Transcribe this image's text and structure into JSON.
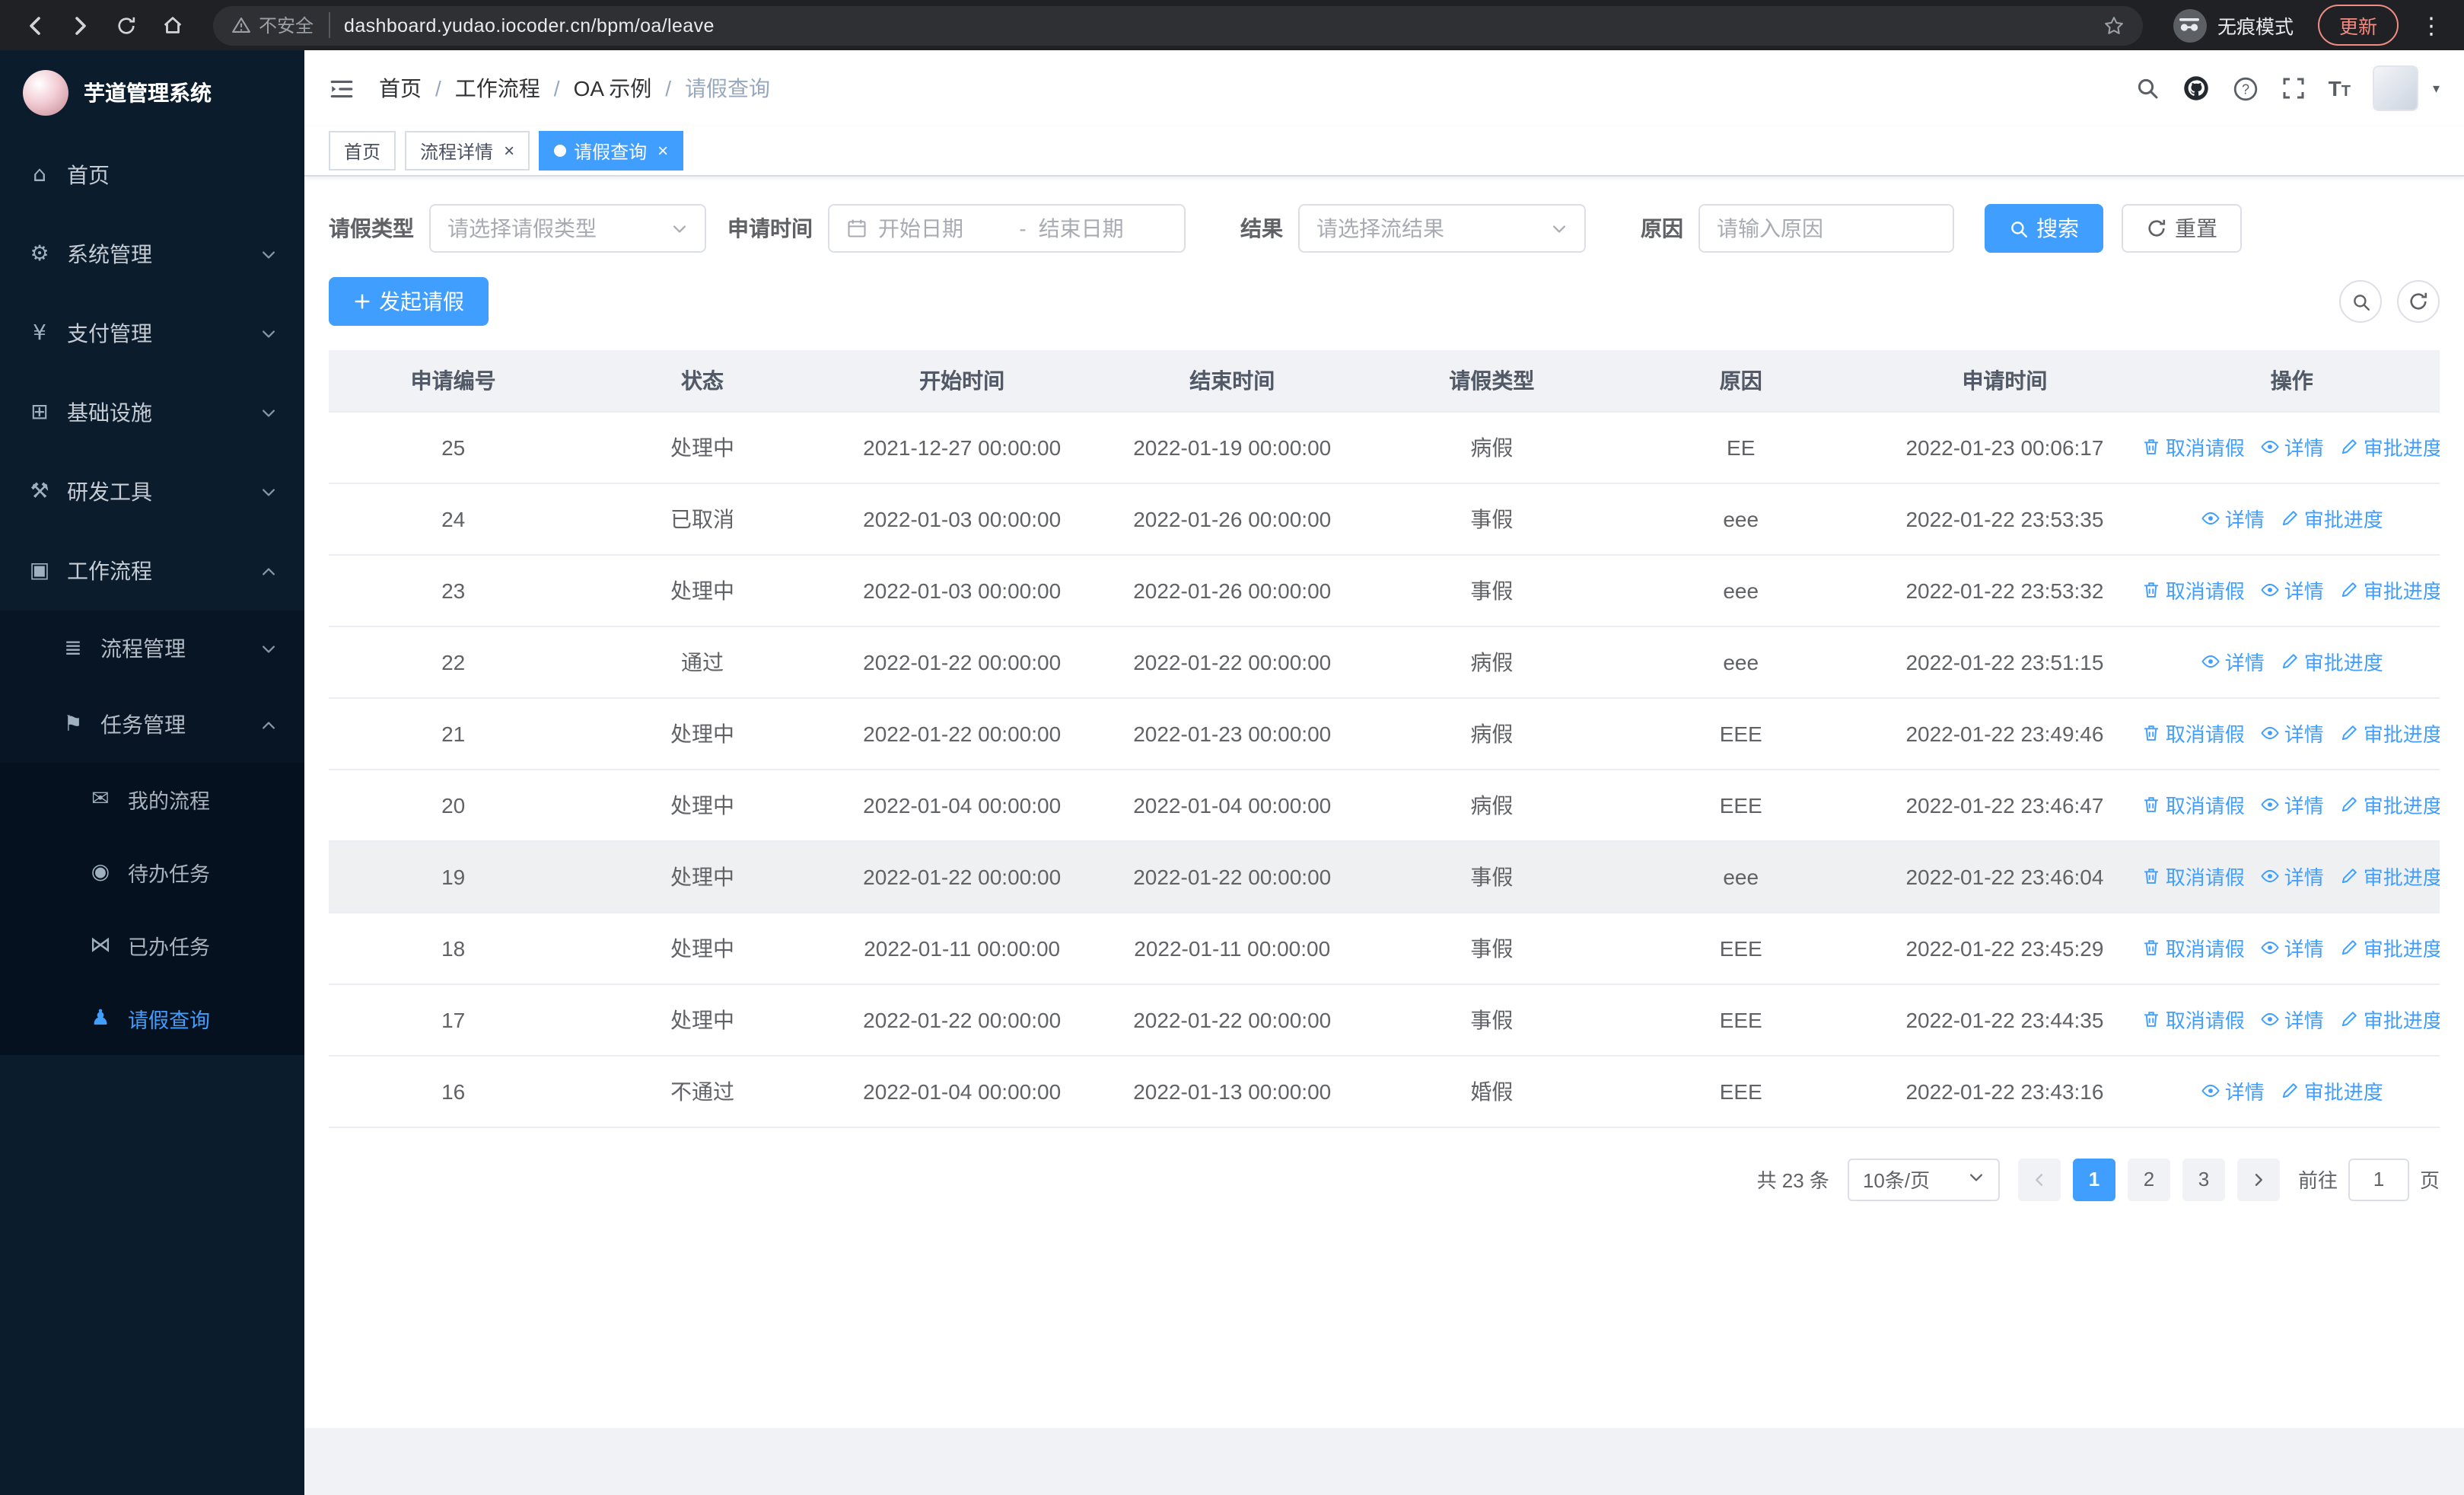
{
  "browser": {
    "security_warning": "不安全",
    "url": "dashboard.yudao.iocoder.cn/bpm/oa/leave",
    "incognito_label": "无痕模式",
    "update_label": "更新"
  },
  "sidebar": {
    "app_title": "芋道管理系统",
    "items": [
      {
        "name": "sidebar-item-home",
        "label": "首页",
        "icon": "home-icon",
        "level": 1
      },
      {
        "name": "sidebar-item-system",
        "label": "系统管理",
        "icon": "gear-icon",
        "level": 1,
        "arrow": "down"
      },
      {
        "name": "sidebar-item-payment",
        "label": "支付管理",
        "icon": "yen-icon",
        "level": 1,
        "arrow": "down"
      },
      {
        "name": "sidebar-item-infrastructure",
        "label": "基础设施",
        "icon": "grid-icon",
        "level": 1,
        "arrow": "down"
      },
      {
        "name": "sidebar-item-devtools",
        "label": "研发工具",
        "icon": "tools-icon",
        "level": 1,
        "arrow": "down"
      },
      {
        "name": "sidebar-item-workflow",
        "label": "工作流程",
        "icon": "workflow-icon",
        "level": 1,
        "arrow": "up"
      },
      {
        "name": "sidebar-item-process-mgmt",
        "label": "流程管理",
        "icon": "list-icon",
        "level": 2,
        "arrow": "down"
      },
      {
        "name": "sidebar-item-task-mgmt",
        "label": "任务管理",
        "icon": "flag-icon",
        "level": 2,
        "arrow": "up"
      },
      {
        "name": "sidebar-item-my-process",
        "label": "我的流程",
        "icon": "message-icon",
        "level": 3
      },
      {
        "name": "sidebar-item-todo-tasks",
        "label": "待办任务",
        "icon": "eye-icon",
        "level": 3
      },
      {
        "name": "sidebar-item-done-tasks",
        "label": "已办任务",
        "icon": "bowtie-icon",
        "level": 3
      },
      {
        "name": "sidebar-item-leave-query",
        "label": "请假查询",
        "icon": "user-icon",
        "level": 3,
        "active": true
      }
    ]
  },
  "header": {
    "breadcrumb": [
      "首页",
      "工作流程",
      "OA 示例",
      "请假查询"
    ]
  },
  "tabs": [
    {
      "name": "tab-home",
      "label": "首页"
    },
    {
      "name": "tab-process-detail",
      "label": "流程详情",
      "closable": true
    },
    {
      "name": "tab-leave-query",
      "label": "请假查询",
      "closable": true,
      "active": true
    }
  ],
  "filters": {
    "leave_type_label": "请假类型",
    "leave_type_placeholder": "请选择请假类型",
    "apply_time_label": "申请时间",
    "start_date_placeholder": "开始日期",
    "date_separator": "-",
    "end_date_placeholder": "结束日期",
    "result_label": "结果",
    "result_placeholder": "请选择流结果",
    "reason_label": "原因",
    "reason_placeholder": "请输入原因",
    "search_button": "搜索",
    "reset_button": "重置"
  },
  "toolbar": {
    "create_button": "发起请假"
  },
  "table": {
    "columns": [
      "申请编号",
      "状态",
      "开始时间",
      "结束时间",
      "请假类型",
      "原因",
      "申请时间",
      "操作"
    ],
    "rows": [
      {
        "id": "25",
        "status": "处理中",
        "start": "2021-12-27 00:00:00",
        "end": "2022-01-19 00:00:00",
        "type": "病假",
        "reason": "EE",
        "applied": "2022-01-23 00:06:17",
        "actions": [
          "取消请假",
          "详情",
          "审批进度"
        ]
      },
      {
        "id": "24",
        "status": "已取消",
        "start": "2022-01-03 00:00:00",
        "end": "2022-01-26 00:00:00",
        "type": "事假",
        "reason": "eee",
        "applied": "2022-01-22 23:53:35",
        "actions": [
          "详情",
          "审批进度"
        ]
      },
      {
        "id": "23",
        "status": "处理中",
        "start": "2022-01-03 00:00:00",
        "end": "2022-01-26 00:00:00",
        "type": "事假",
        "reason": "eee",
        "applied": "2022-01-22 23:53:32",
        "actions": [
          "取消请假",
          "详情",
          "审批进度"
        ]
      },
      {
        "id": "22",
        "status": "通过",
        "start": "2022-01-22 00:00:00",
        "end": "2022-01-22 00:00:00",
        "type": "病假",
        "reason": "eee",
        "applied": "2022-01-22 23:51:15",
        "actions": [
          "详情",
          "审批进度"
        ]
      },
      {
        "id": "21",
        "status": "处理中",
        "start": "2022-01-22 00:00:00",
        "end": "2022-01-23 00:00:00",
        "type": "病假",
        "reason": "EEE",
        "applied": "2022-01-22 23:49:46",
        "actions": [
          "取消请假",
          "详情",
          "审批进度"
        ]
      },
      {
        "id": "20",
        "status": "处理中",
        "start": "2022-01-04 00:00:00",
        "end": "2022-01-04 00:00:00",
        "type": "病假",
        "reason": "EEE",
        "applied": "2022-01-22 23:46:47",
        "actions": [
          "取消请假",
          "详情",
          "审批进度"
        ]
      },
      {
        "id": "19",
        "status": "处理中",
        "start": "2022-01-22 00:00:00",
        "end": "2022-01-22 00:00:00",
        "type": "事假",
        "reason": "eee",
        "applied": "2022-01-22 23:46:04",
        "actions": [
          "取消请假",
          "详情",
          "审批进度"
        ],
        "highlighted": true
      },
      {
        "id": "18",
        "status": "处理中",
        "start": "2022-01-11 00:00:00",
        "end": "2022-01-11 00:00:00",
        "type": "事假",
        "reason": "EEE",
        "applied": "2022-01-22 23:45:29",
        "actions": [
          "取消请假",
          "详情",
          "审批进度"
        ]
      },
      {
        "id": "17",
        "status": "处理中",
        "start": "2022-01-22 00:00:00",
        "end": "2022-01-22 00:00:00",
        "type": "事假",
        "reason": "EEE",
        "applied": "2022-01-22 23:44:35",
        "actions": [
          "取消请假",
          "详情",
          "审批进度"
        ]
      },
      {
        "id": "16",
        "status": "不通过",
        "start": "2022-01-04 00:00:00",
        "end": "2022-01-13 00:00:00",
        "type": "婚假",
        "reason": "EEE",
        "applied": "2022-01-22 23:43:16",
        "actions": [
          "详情",
          "审批进度"
        ]
      }
    ]
  },
  "pagination": {
    "total_text": "共 23 条",
    "page_size": "10条/页",
    "pages": [
      "1",
      "2",
      "3"
    ],
    "active_page": "1",
    "goto_label": "前往",
    "goto_value": "1",
    "goto_suffix": "页"
  },
  "colors": {
    "accent": "#409eff",
    "sidebar_bg": "#0b1c2d",
    "update_warning": "#f28b82"
  }
}
